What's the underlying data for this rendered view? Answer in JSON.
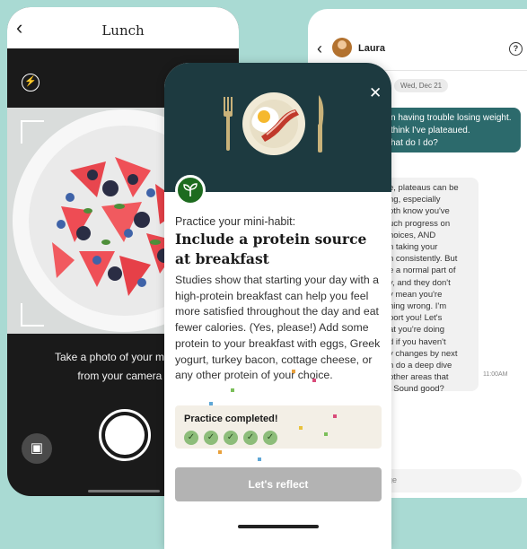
{
  "left_phone": {
    "back_glyph": "‹",
    "title": "Lunch",
    "flash_icon": "flash-icon",
    "caption_line1": "Take a photo of your meal or",
    "caption_line2": "from your camera r"
  },
  "right_phone": {
    "contact_name": "Laura",
    "date_chip": "Wed, Dec 21",
    "outgoing_lines": [
      "n having trouble losing weight.",
      "think I've plateaued.",
      "hat do I do?"
    ],
    "incoming_lines": [
      "e, plateaus can be",
      "ng, especially",
      "oth know you've",
      "uch progress on",
      "hoices, AND",
      "n taking your",
      "n consistently. But",
      "e a normal part of",
      "y, and they don't",
      "y mean you're",
      "hing wrong. I'm",
      "port you! Let's",
      "at you're doing",
      "d if you haven't",
      "y changes by next",
      "n do a deep dive",
      "other areas that",
      ". Sound good?"
    ],
    "time": "11:00AM",
    "input_placeholder": "age"
  },
  "center_phone": {
    "subheading": "Practice your mini-habit:",
    "title": "Include a protein source at breakfast",
    "body": "Studies show that starting your day with a high-protein breakfast can help you feel more satisfied throughout the day and eat fewer calories. (Yes, please!) Add some protein to your breakfast with eggs, Greek yogurt, turkey bacon, cottage cheese, or any other protein of your choice.",
    "practice_label": "Practice completed!",
    "check_count": 5,
    "reflect_button": "Let's reflect"
  },
  "colors": {
    "background": "#a9dad3",
    "header_dark": "#1d3a40",
    "badge_green": "#1d6b1f",
    "chat_bubble": "#2c6a6c",
    "check_green": "#8dbd7a"
  }
}
